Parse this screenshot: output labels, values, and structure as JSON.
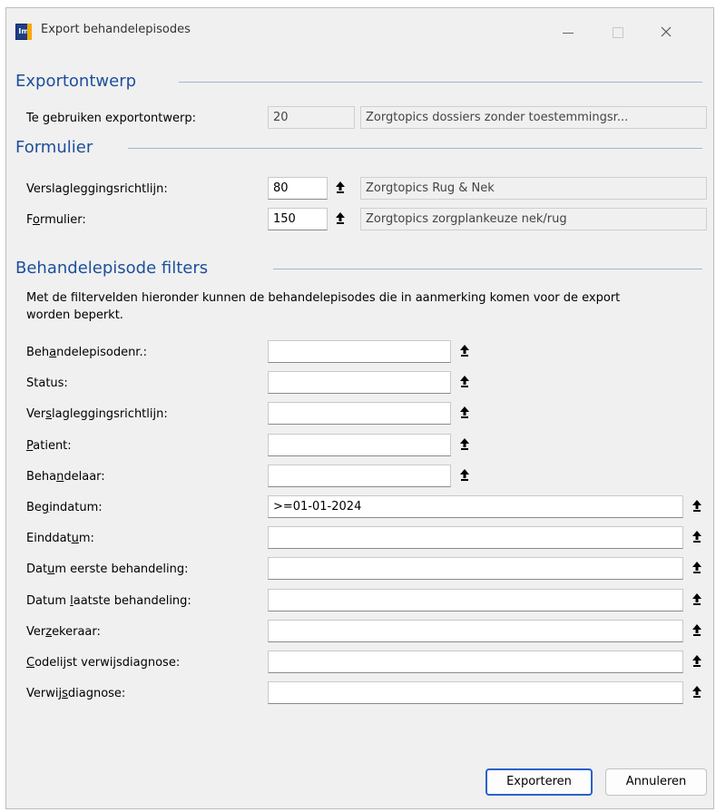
{
  "window": {
    "title": "Export behandelepisodes",
    "app_icon_text": "Im"
  },
  "sections": {
    "export_design": "Exportontwerp",
    "form": "Formulier",
    "filters": "Behandelepisode filters"
  },
  "export_design": {
    "label": "Te gebruiken exportontwerp:",
    "code": "20",
    "name": "Zorgtopics dossiers zonder toestemmingsr..."
  },
  "form": {
    "guideline_label": "Verslagleggingsrichtlijn:",
    "guideline_code": "80",
    "guideline_name": "Zorgtopics Rug & Nek",
    "form_label_pre": "F",
    "form_label_u": "o",
    "form_label_post": "rmulier:",
    "form_code": "150",
    "form_name": "Zorgtopics zorgplankeuze nek/rug"
  },
  "filters_description": "Met de filtervelden hieronder kunnen de behandelepisodes die in aanmerking komen voor de export worden beperkt.",
  "filters": [
    {
      "pre": "Beh",
      "u": "a",
      "post": "ndelepisodenr.:",
      "value": ""
    },
    {
      "pre": "Status:",
      "u": "",
      "post": "",
      "value": ""
    },
    {
      "pre": "Ver",
      "u": "s",
      "post": "lagleggingsrichtlijn:",
      "value": ""
    },
    {
      "pre": "",
      "u": "P",
      "post": "atient:",
      "value": ""
    },
    {
      "pre": "Beha",
      "u": "n",
      "post": "delaar:",
      "value": ""
    },
    {
      "pre": "Be",
      "u": "g",
      "post": "indatum:",
      "value": ">=01-01-2024"
    },
    {
      "pre": "Einddat",
      "u": "u",
      "post": "m:",
      "value": ""
    },
    {
      "pre": "Dat",
      "u": "u",
      "post": "m eerste behandeling:",
      "value": ""
    },
    {
      "pre": "Datum ",
      "u": "l",
      "post": "aatste behandeling:",
      "value": ""
    },
    {
      "pre": "Ver",
      "u": "z",
      "post": "ekeraar:",
      "value": ""
    },
    {
      "pre": "",
      "u": "C",
      "post": "odelijst verwijsdiagnose:",
      "value": ""
    },
    {
      "pre": "Verwij",
      "u": "s",
      "post": "diagnose:",
      "value": ""
    }
  ],
  "buttons": {
    "export": "Exporteren",
    "cancel": "Annuleren"
  },
  "icons": {
    "lookup": "lookup-arrow-icon",
    "minimize": "minimize-icon",
    "maximize": "maximize-icon",
    "close": "close-icon"
  }
}
